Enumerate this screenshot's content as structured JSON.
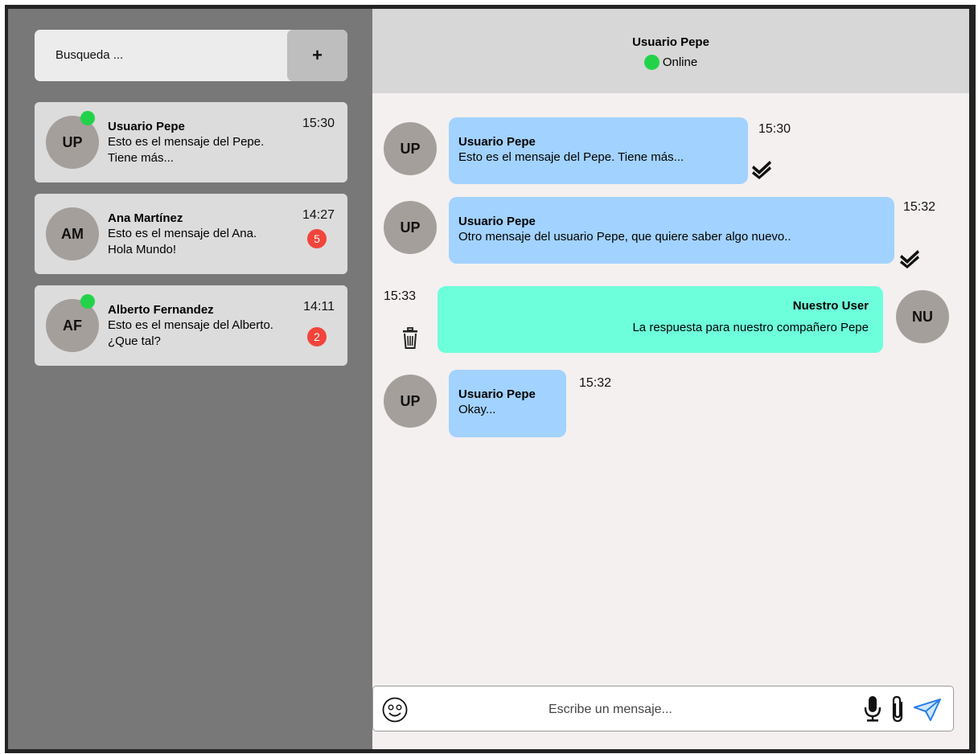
{
  "search": {
    "placeholder": "Busqueda ...",
    "add_label": "+"
  },
  "conversations": [
    {
      "initials": "UP",
      "name": "Usuario Pepe",
      "preview": "Esto es el mensaje del Pepe. Tiene más...",
      "time": "15:30",
      "online": true,
      "unread": ""
    },
    {
      "initials": "AM",
      "name": "Ana Martínez",
      "preview": "Esto es el mensaje del Ana. Hola Mundo!",
      "time": "14:27",
      "online": false,
      "unread": "5"
    },
    {
      "initials": "AF",
      "name": "Alberto Fernandez",
      "preview": "Esto es el mensaje del Alberto. ¿Que tal?",
      "time": "14:11",
      "online": true,
      "unread": "2"
    }
  ],
  "chat": {
    "contact_name": "Usuario Pepe",
    "status": "Online",
    "messages": [
      {
        "direction": "incoming",
        "initials": "UP",
        "sender": "Usuario Pepe",
        "text": "Esto es el mensaje del Pepe. Tiene más...",
        "time": "15:30",
        "read": true
      },
      {
        "direction": "incoming",
        "initials": "UP",
        "sender": "Usuario Pepe",
        "text": "Otro mensaje del usuario Pepe, que quiere saber algo nuevo..",
        "time": "15:32",
        "read": true
      },
      {
        "direction": "outgoing",
        "initials": "NU",
        "sender": "Nuestro User",
        "text": "La respuesta para nuestro compañero Pepe",
        "time": "15:33",
        "read": false
      },
      {
        "direction": "incoming",
        "initials": "UP",
        "sender": "Usuario Pepe",
        "text": "Okay...",
        "time": "15:32",
        "read": false
      }
    ]
  },
  "composer": {
    "placeholder": "Escribe un mensaje..."
  },
  "colors": {
    "sidebar_bg": "#787878",
    "incoming_bubble": "#a2d2ff",
    "outgoing_bubble": "#6dffdb",
    "online": "#22d34a",
    "badge": "#f2443a"
  },
  "icons": {
    "emoji": "smiley-face-icon",
    "mic": "microphone-icon",
    "attach": "paperclip-icon",
    "send": "paper-plane-send-icon",
    "delete": "trash-icon",
    "read": "double-check-icon"
  }
}
